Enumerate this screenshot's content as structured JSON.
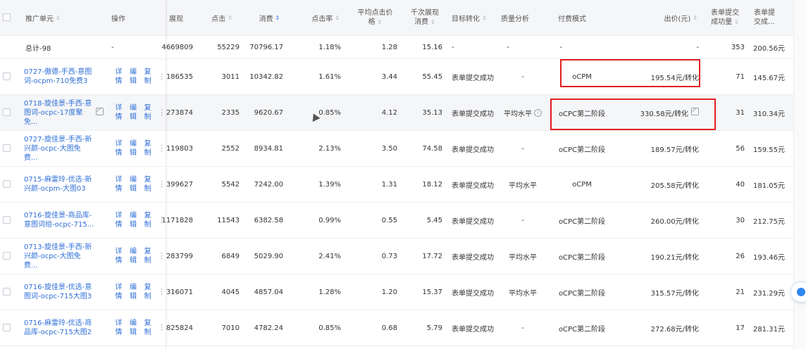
{
  "header": {
    "unit": "推广单元",
    "ops": "操作",
    "impressions": "展现",
    "clicks": "点击",
    "cost": "消费",
    "ctr": "点击率",
    "cpc_l1": "平均点击价",
    "cpc_l2": "格",
    "cpm_l1": "千次展现",
    "cpm_l2": "消费",
    "goal": "目标转化",
    "quality": "质量分析",
    "pay": "付费模式",
    "bid": "出价(元)",
    "conv_l1": "表单提交",
    "conv_l2": "成功量",
    "cpa_l1": "表单提",
    "cpa_l2": "交成..."
  },
  "total": {
    "label": "总计-98",
    "ops": "-",
    "impressions": "4669809",
    "clicks": "55229",
    "cost": "70796.17",
    "ctr": "1.18%",
    "cpc": "1.28",
    "cpm": "15.16",
    "goal": "-",
    "quality": "-",
    "pay": "-",
    "bid": "-",
    "conv": "353",
    "cpa": "200.56元"
  },
  "op_labels": {
    "detail": "详\n情",
    "edit": "编\n辑",
    "copy": "复\n制"
  },
  "rows": [
    {
      "name": "0727-傲德-手西-意图\n词-ocpm-710免费3",
      "impressions": "186535",
      "clicks": "3011",
      "cost": "10342.82",
      "ctr": "1.61%",
      "cpc": "3.44",
      "cpm": "55.45",
      "goal": "表单提交成功",
      "quality": "-",
      "pay": "oCPM",
      "bid": "195.54元/转化",
      "conv": "71",
      "cpa": "145.67元"
    },
    {
      "name": "0718-旋佳景-手西-意\n图词-ocpc-17度聚免...",
      "impressions": "273874",
      "clicks": "2335",
      "cost": "9620.67",
      "ctr": "0.85%",
      "cpc": "4.12",
      "cpm": "35.13",
      "goal": "表单提交成功",
      "quality": "平均水平",
      "pay": "oCPC第二阶段",
      "bid": "330.58元/转化",
      "conv": "31",
      "cpa": "310.34元"
    },
    {
      "name": "0727-旋佳景-手西-新\n兴颜-ocpc-大图免费...",
      "impressions": "119803",
      "clicks": "2552",
      "cost": "8934.81",
      "ctr": "2.13%",
      "cpc": "3.50",
      "cpm": "74.58",
      "goal": "表单提交成功",
      "quality": "-",
      "pay": "oCPC第二阶段",
      "bid": "189.57元/转化",
      "conv": "56",
      "cpa": "159.55元"
    },
    {
      "name": "0715-麻雷玲-优选-新\n兴颜-ocpm-大图03",
      "impressions": "399627",
      "clicks": "5542",
      "cost": "7242.00",
      "ctr": "1.39%",
      "cpc": "1.31",
      "cpm": "18.12",
      "goal": "表单提交成功",
      "quality": "平均水平",
      "pay": "oCPM",
      "bid": "205.58元/转化",
      "conv": "40",
      "cpa": "181.05元"
    },
    {
      "name": "0716-旋佳景-商品库-\n意图词组-ocpc-715...",
      "impressions": "1171828",
      "clicks": "11543",
      "cost": "6382.58",
      "ctr": "0.99%",
      "cpc": "0.55",
      "cpm": "5.45",
      "goal": "表单提交成功",
      "quality": "-",
      "pay": "oCPC第二阶段",
      "bid": "260.00元/转化",
      "conv": "30",
      "cpa": "212.75元"
    },
    {
      "name": "0713-旋佳景-手西-新\n兴颜-ocpc-大图免费...",
      "impressions": "283799",
      "clicks": "6849",
      "cost": "5029.90",
      "ctr": "2.41%",
      "cpc": "0.73",
      "cpm": "17.72",
      "goal": "表单提交成功",
      "quality": "平均水平",
      "pay": "oCPC第二阶段",
      "bid": "190.21元/转化",
      "conv": "26",
      "cpa": "193.46元"
    },
    {
      "name": "0716-旋佳景-优选-意\n图词-ocpc-715大图3",
      "impressions": "316071",
      "clicks": "4045",
      "cost": "4857.04",
      "ctr": "1.28%",
      "cpc": "1.20",
      "cpm": "15.37",
      "goal": "表单提交成功",
      "quality": "平均水平",
      "pay": "oCPC第二阶段",
      "bid": "315.57元/转化",
      "conv": "21",
      "cpa": "231.29元"
    },
    {
      "name": "0716-麻雷玲-优选-商\n品库-ocpc-715大图2",
      "impressions": "825824",
      "clicks": "7010",
      "cost": "4782.24",
      "ctr": "0.85%",
      "cpc": "0.68",
      "cpm": "5.79",
      "goal": "表单提交成功",
      "quality": "-",
      "pay": "oCPC第二阶段",
      "bid": "272.68元/转化",
      "conv": "17",
      "cpa": "281.31元"
    }
  ],
  "colors": {
    "link": "#2f6fd8",
    "highlight": "#e02020",
    "sort_active": "#3d7cf0"
  }
}
